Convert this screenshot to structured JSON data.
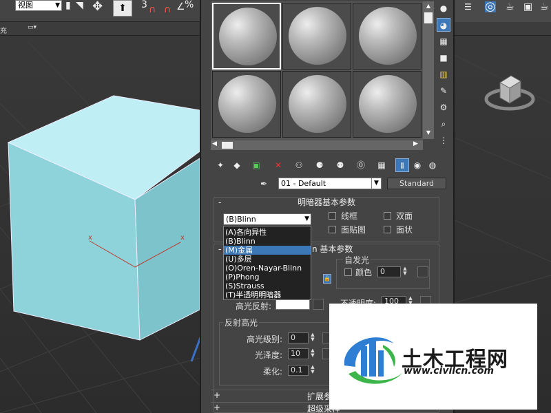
{
  "toolbar": {
    "view_combo": "视图",
    "snap_number": "3",
    "percent": "%",
    "filling_label": "充"
  },
  "material_editor": {
    "material_name": "01 - Default",
    "material_type": "Standard",
    "shader_rollout": {
      "sign": "-",
      "title": "明暗器基本参数",
      "shader_value": "(B)Blinn",
      "wire_label": "线框",
      "two_sided_label": "双面",
      "face_map_label": "面贴图",
      "faceted_label": "面状"
    },
    "shader_options": [
      "(A)各向异性",
      "(B)Blinn",
      "(M)金属",
      "(U)多层",
      "(O)Oren-Nayar-Blinn",
      "(P)Phong",
      "(S)Strauss",
      "(T)半透明明暗器"
    ],
    "shader_options_highlighted": 2,
    "basic_params": {
      "sign": "-",
      "title_tail": "n 基本参数",
      "self_illum_label": "自发光",
      "color_label": "颜色",
      "color_value": "0",
      "specular_label": "高光反射:",
      "opacity_label": "不透明度:",
      "opacity_value": "100"
    },
    "specular_highlights": {
      "title": "反射高光",
      "level_label": "高光级别:",
      "level_value": "0",
      "gloss_label": "光泽度:",
      "gloss_value": "10",
      "soften_label": "柔化:",
      "soften_value": "0.1"
    },
    "extended_rollout": {
      "sign": "+",
      "title": "扩展参"
    },
    "supersampling_rollout": {
      "sign": "+",
      "title": "超级采样"
    }
  },
  "viewport": {
    "axis_x": "x",
    "cube_color": "#8fd0d8"
  },
  "watermark": {
    "text": "土木工程网",
    "url": "www.civilcn.com"
  }
}
